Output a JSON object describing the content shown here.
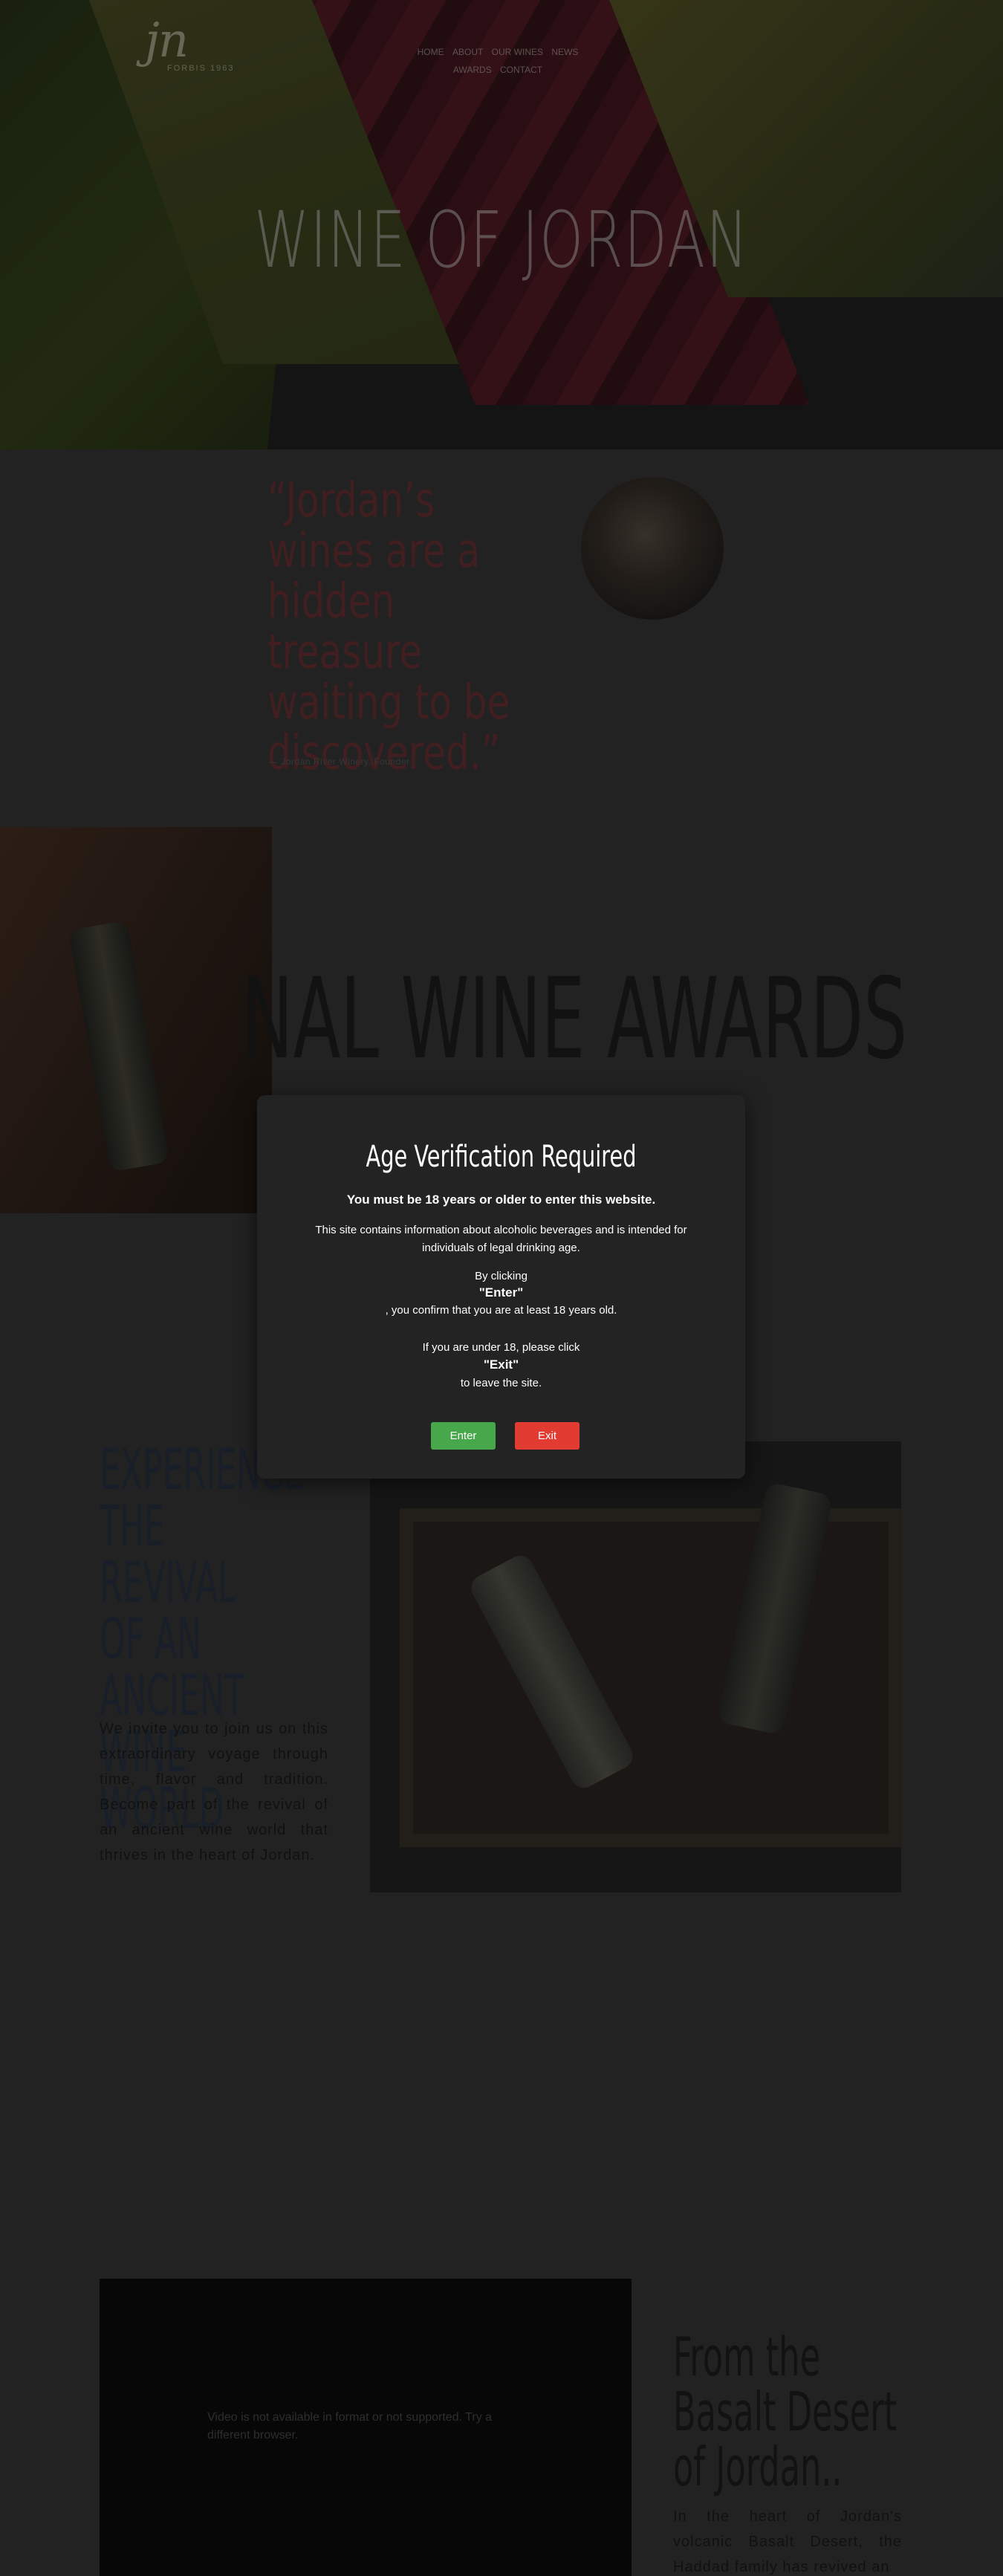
{
  "header": {
    "logo_script": "jn",
    "logo_sub": "FORBIS 1963",
    "nav": [
      "HOME",
      "ABOUT",
      "OUR WINES",
      "NEWS",
      "AWARDS",
      "CONTACT"
    ]
  },
  "hero": {
    "title": "WINE OF JORDAN"
  },
  "quote": {
    "text": "“Jordan’s wines are a hidden treasure waiting to be discovered.”",
    "credit": "— Jordan River Winery, Founder"
  },
  "awards": {
    "title": "NAL WINE AWARDS"
  },
  "experience": {
    "title": "EXPERIENCE THE REVIVAL OF AN ANCIENT WINE WORLD",
    "body": "We invite you to join us on this extraordinary voyage through time, flavor and tradition. Become part of the revival of an ancient wine world that thrives in the heart of Jordan."
  },
  "basalt": {
    "video_message": "Video is not available in format or not supported. Try a different browser.",
    "title": "From the Basalt Desert of Jordan..",
    "body": "In the heart of Jordan's volcanic Basalt Desert, the Haddad family has revived an"
  },
  "modal": {
    "title": "Age Verification Required",
    "subtitle": "You must be 18 years or older to enter this website.",
    "description": "This site contains information about alcoholic beverages and is intended for individuals of legal drinking age.",
    "by_clicking": "By clicking",
    "enter_quote": "\"Enter\"",
    "confirm": ", you confirm that you are at least 18 years old.",
    "if_under": "If you are under 18, please click",
    "exit_quote": "\"Exit\"",
    "leave": "to leave the site.",
    "enter_button": "Enter",
    "exit_button": "Exit"
  },
  "colors": {
    "enter_button": "#47a84b",
    "exit_button": "#e23b32",
    "modal_bg": "#232323",
    "quote_red": "#5a2426"
  }
}
